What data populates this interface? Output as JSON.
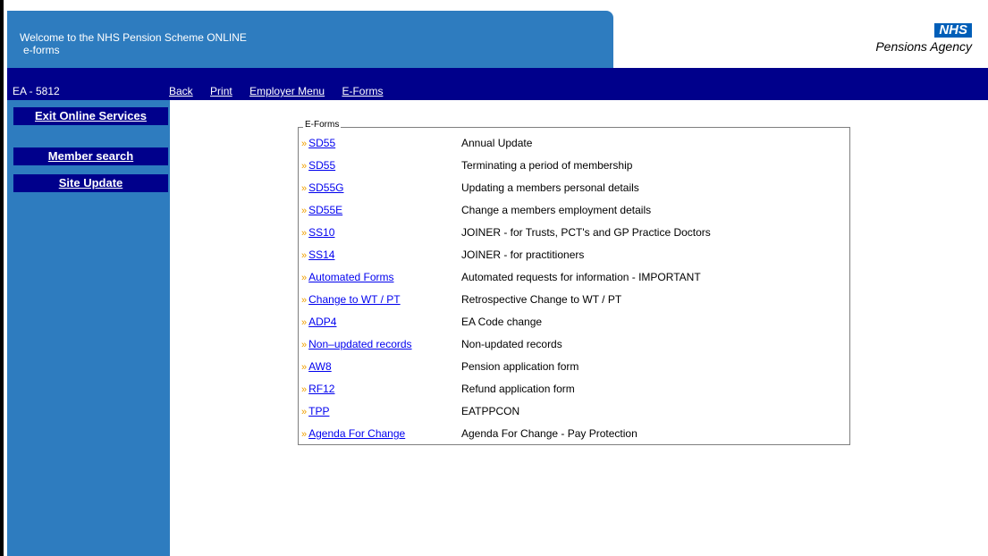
{
  "header": {
    "welcome_line1": "Welcome to the NHS Pension Scheme ONLINE",
    "welcome_line2": "e-forms",
    "logo_nhs": "NHS",
    "logo_agency": "Pensions Agency"
  },
  "navbar": {
    "ea_code": "EA - 5812",
    "links": [
      "Back",
      "Print",
      "Employer Menu",
      "E-Forms"
    ]
  },
  "sidebar": {
    "items": [
      "Exit Online Services",
      "Member search",
      "Site Update"
    ]
  },
  "eforms": {
    "legend": "E-Forms",
    "rows": [
      {
        "link": "SD55",
        "desc": "Annual Update"
      },
      {
        "link": "SD55",
        "desc": "Terminating a period of membership"
      },
      {
        "link": "SD55G",
        "desc": "Updating a members personal details"
      },
      {
        "link": "SD55E",
        "desc": "Change a members employment details"
      },
      {
        "link": "SS10",
        "desc": "JOINER - for Trusts, PCT's and GP Practice Doctors"
      },
      {
        "link": "SS14",
        "desc": "JOINER - for practitioners"
      },
      {
        "link": "Automated Forms",
        "desc": "Automated requests for information - IMPORTANT"
      },
      {
        "link": "Change to WT / PT",
        "desc": "Retrospective Change to WT / PT"
      },
      {
        "link": "ADP4",
        "desc": "EA Code change"
      },
      {
        "link": "Non–updated records",
        "desc": "Non-updated records"
      },
      {
        "link": "AW8",
        "desc": "Pension application form"
      },
      {
        "link": "RF12",
        "desc": "Refund application form"
      },
      {
        "link": "TPP",
        "desc": "EATPPCON"
      },
      {
        "link": "Agenda For Change",
        "desc": "Agenda For Change - Pay Protection"
      }
    ],
    "arrow_glyph": "»"
  },
  "colors": {
    "header_blue": "#2e7cbf",
    "nav_navy": "#00008b",
    "link_blue": "#0000ee",
    "arrow_orange": "#f0a000"
  }
}
